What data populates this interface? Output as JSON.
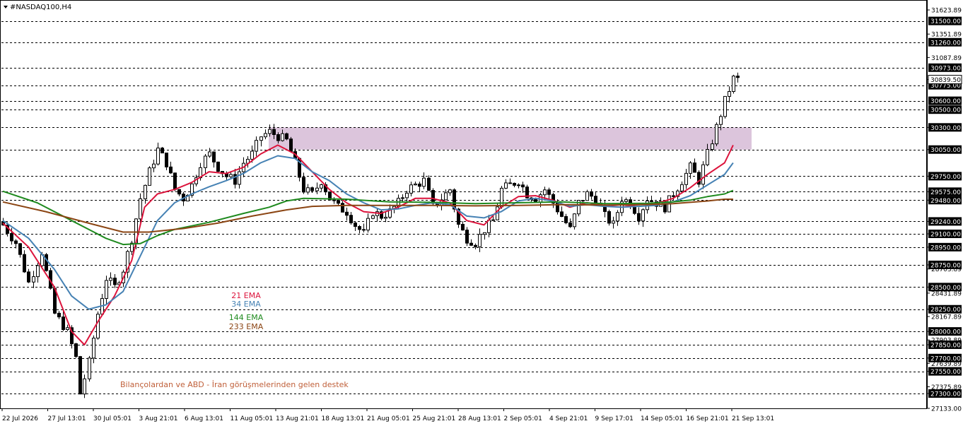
{
  "symbol_label": "#NASDAQ100,H4",
  "colors": {
    "background": "#ffffff",
    "candle": "#000000",
    "grid": "#000000",
    "ema21": "#dc143c",
    "ema34": "#4682b4",
    "ema144": "#1f8a1f",
    "ema233": "#8b4513",
    "zone": "#d8bfd8",
    "tag_bg": "#000000",
    "tag_fg": "#ffffff",
    "note": "#c0603a"
  },
  "legend": [
    {
      "label": "21 EMA",
      "color": "#dc143c"
    },
    {
      "label": "34 EMA",
      "color": "#4682b4"
    },
    {
      "label": "144 EMA",
      "color": "#1f8a1f"
    },
    {
      "label": "233 EMA",
      "color": "#8b4513"
    }
  ],
  "annotation": "Bilançolardan ve ABD - İran görüşmelerinden gelen destek",
  "chart_data": {
    "type": "candlestick",
    "title": "#NASDAQ100,H4",
    "timeframe": "H4",
    "ylim": [
      27133,
      31720
    ],
    "x_ticks": [
      "22 Jul 2026",
      "27 Jul 13:01",
      "30 Jul 05:01",
      "3 Aug 21:01",
      "6 Aug 13:01",
      "11 Aug 05:01",
      "13 Aug 21:01",
      "18 Aug 13:01",
      "21 Aug 05:01",
      "25 Aug 21:01",
      "28 Aug 13:01",
      "2 Sep 05:01",
      "4 Sep 21:01",
      "9 Sep 17:01",
      "14 Sep 05:01",
      "16 Sep 21:01",
      "21 Sep 13:01"
    ],
    "y_scale_labels": [
      "31623.89",
      "31351.89",
      "31087.89",
      "30839.50",
      "30300.00",
      "30050.00",
      "29750.00",
      "29575.00",
      "29480.00",
      "29240.00",
      "29100.00",
      "28950.00",
      "28750.00",
      "28703.89",
      "28500.00",
      "28431.89",
      "28250.00",
      "28167.89",
      "28000.00",
      "27903.89",
      "27850.00",
      "27700.00",
      "27639.89",
      "27550.00",
      "27375.89",
      "27300.00",
      "27133.00"
    ],
    "horizontal_levels": [
      "31500.00",
      "31260.00",
      "30973.00",
      "30775.00",
      "30600.00",
      "30500.00",
      "30300.00",
      "30050.00",
      "29750.00",
      "29575.00",
      "29480.00",
      "29240.00",
      "29100.00",
      "28950.00",
      "28750.00",
      "28500.00",
      "28250.00",
      "28000.00",
      "27850.00",
      "27700.00",
      "27550.00",
      "27300.00"
    ],
    "current_price": "30839.50",
    "zone": {
      "from_date": "13 Aug 05:01",
      "low": 30050,
      "high": 30300
    },
    "close_path": [
      [
        0,
        29200
      ],
      [
        3,
        29000
      ],
      [
        6,
        28550
      ],
      [
        9,
        28900
      ],
      [
        12,
        28200
      ],
      [
        15,
        28000
      ],
      [
        17,
        27700
      ],
      [
        18,
        27300
      ],
      [
        20,
        27650
      ],
      [
        22,
        28200
      ],
      [
        24,
        28600
      ],
      [
        26,
        28500
      ],
      [
        28,
        28700
      ],
      [
        30,
        29050
      ],
      [
        32,
        29500
      ],
      [
        34,
        29800
      ],
      [
        36,
        30050
      ],
      [
        38,
        29900
      ],
      [
        40,
        29600
      ],
      [
        42,
        29500
      ],
      [
        44,
        29650
      ],
      [
        46,
        29900
      ],
      [
        48,
        30000
      ],
      [
        50,
        29850
      ],
      [
        52,
        29750
      ],
      [
        54,
        29700
      ],
      [
        56,
        29900
      ],
      [
        58,
        30000
      ],
      [
        60,
        30200
      ],
      [
        62,
        30250
      ],
      [
        64,
        30200
      ],
      [
        66,
        30150
      ],
      [
        68,
        29900
      ],
      [
        70,
        29600
      ],
      [
        72,
        29550
      ],
      [
        74,
        29700
      ],
      [
        76,
        29500
      ],
      [
        78,
        29400
      ],
      [
        80,
        29350
      ],
      [
        82,
        29200
      ],
      [
        84,
        29100
      ],
      [
        86,
        29350
      ],
      [
        88,
        29300
      ],
      [
        90,
        29350
      ],
      [
        92,
        29450
      ],
      [
        94,
        29600
      ],
      [
        96,
        29650
      ],
      [
        98,
        29700
      ],
      [
        100,
        29400
      ],
      [
        102,
        29500
      ],
      [
        104,
        29600
      ],
      [
        106,
        29200
      ],
      [
        108,
        29050
      ],
      [
        110,
        29000
      ],
      [
        112,
        29150
      ],
      [
        114,
        29250
      ],
      [
        116,
        29600
      ],
      [
        118,
        29650
      ],
      [
        120,
        29700
      ],
      [
        122,
        29550
      ],
      [
        124,
        29500
      ],
      [
        126,
        29600
      ],
      [
        128,
        29450
      ],
      [
        130,
        29300
      ],
      [
        132,
        29150
      ],
      [
        134,
        29450
      ],
      [
        136,
        29550
      ],
      [
        138,
        29500
      ],
      [
        140,
        29300
      ],
      [
        142,
        29200
      ],
      [
        144,
        29500
      ],
      [
        146,
        29450
      ],
      [
        148,
        29300
      ],
      [
        150,
        29500
      ],
      [
        152,
        29450
      ],
      [
        154,
        29400
      ],
      [
        156,
        29550
      ],
      [
        158,
        29700
      ],
      [
        160,
        29850
      ],
      [
        162,
        29700
      ],
      [
        164,
        30000
      ],
      [
        166,
        30300
      ],
      [
        168,
        30600
      ],
      [
        170,
        30850
      ],
      [
        171,
        30839.5
      ]
    ],
    "series": [
      {
        "name": "21 EMA",
        "values": [
          [
            0,
            29220
          ],
          [
            6,
            28950
          ],
          [
            12,
            28500
          ],
          [
            16,
            28000
          ],
          [
            19,
            27850
          ],
          [
            22,
            28100
          ],
          [
            26,
            28400
          ],
          [
            30,
            28800
          ],
          [
            33,
            29400
          ],
          [
            36,
            29550
          ],
          [
            40,
            29600
          ],
          [
            44,
            29680
          ],
          [
            48,
            29800
          ],
          [
            52,
            29780
          ],
          [
            56,
            29850
          ],
          [
            60,
            30000
          ],
          [
            64,
            30100
          ],
          [
            68,
            30000
          ],
          [
            72,
            29800
          ],
          [
            76,
            29600
          ],
          [
            80,
            29450
          ],
          [
            84,
            29350
          ],
          [
            88,
            29330
          ],
          [
            92,
            29400
          ],
          [
            96,
            29500
          ],
          [
            100,
            29500
          ],
          [
            104,
            29450
          ],
          [
            108,
            29250
          ],
          [
            112,
            29200
          ],
          [
            116,
            29400
          ],
          [
            120,
            29520
          ],
          [
            124,
            29530
          ],
          [
            128,
            29480
          ],
          [
            132,
            29400
          ],
          [
            136,
            29450
          ],
          [
            140,
            29420
          ],
          [
            144,
            29400
          ],
          [
            148,
            29430
          ],
          [
            152,
            29440
          ],
          [
            156,
            29500
          ],
          [
            160,
            29620
          ],
          [
            164,
            29770
          ],
          [
            168,
            29900
          ],
          [
            170,
            30100
          ]
        ]
      },
      {
        "name": "34 EMA",
        "values": [
          [
            0,
            29250
          ],
          [
            6,
            29050
          ],
          [
            12,
            28700
          ],
          [
            16,
            28400
          ],
          [
            20,
            28250
          ],
          [
            24,
            28300
          ],
          [
            28,
            28450
          ],
          [
            32,
            28850
          ],
          [
            36,
            29250
          ],
          [
            40,
            29450
          ],
          [
            44,
            29550
          ],
          [
            48,
            29630
          ],
          [
            52,
            29700
          ],
          [
            56,
            29780
          ],
          [
            60,
            29900
          ],
          [
            64,
            29980
          ],
          [
            68,
            29950
          ],
          [
            72,
            29800
          ],
          [
            76,
            29700
          ],
          [
            80,
            29550
          ],
          [
            84,
            29450
          ],
          [
            88,
            29370
          ],
          [
            92,
            29380
          ],
          [
            96,
            29420
          ],
          [
            100,
            29450
          ],
          [
            104,
            29430
          ],
          [
            108,
            29300
          ],
          [
            112,
            29280
          ],
          [
            116,
            29350
          ],
          [
            120,
            29470
          ],
          [
            124,
            29500
          ],
          [
            128,
            29470
          ],
          [
            132,
            29410
          ],
          [
            136,
            29430
          ],
          [
            140,
            29410
          ],
          [
            144,
            29400
          ],
          [
            148,
            29410
          ],
          [
            152,
            29420
          ],
          [
            156,
            29460
          ],
          [
            160,
            29530
          ],
          [
            164,
            29650
          ],
          [
            168,
            29770
          ],
          [
            170,
            29900
          ]
        ]
      },
      {
        "name": "144 EMA",
        "values": [
          [
            0,
            29580
          ],
          [
            8,
            29450
          ],
          [
            16,
            29250
          ],
          [
            24,
            29050
          ],
          [
            28,
            28980
          ],
          [
            32,
            28990
          ],
          [
            36,
            29080
          ],
          [
            40,
            29150
          ],
          [
            48,
            29230
          ],
          [
            56,
            29330
          ],
          [
            62,
            29400
          ],
          [
            66,
            29470
          ],
          [
            70,
            29500
          ],
          [
            80,
            29490
          ],
          [
            90,
            29460
          ],
          [
            100,
            29455
          ],
          [
            110,
            29440
          ],
          [
            120,
            29450
          ],
          [
            130,
            29460
          ],
          [
            140,
            29440
          ],
          [
            150,
            29445
          ],
          [
            156,
            29460
          ],
          [
            160,
            29480
          ],
          [
            164,
            29520
          ],
          [
            168,
            29550
          ],
          [
            170,
            29590
          ]
        ]
      },
      {
        "name": "233 EMA",
        "values": [
          [
            0,
            29460
          ],
          [
            10,
            29350
          ],
          [
            20,
            29220
          ],
          [
            28,
            29120
          ],
          [
            34,
            29120
          ],
          [
            42,
            29160
          ],
          [
            50,
            29220
          ],
          [
            58,
            29300
          ],
          [
            66,
            29370
          ],
          [
            72,
            29410
          ],
          [
            80,
            29420
          ],
          [
            90,
            29420
          ],
          [
            100,
            29420
          ],
          [
            110,
            29415
          ],
          [
            120,
            29420
          ],
          [
            130,
            29430
          ],
          [
            140,
            29425
          ],
          [
            150,
            29430
          ],
          [
            156,
            29440
          ],
          [
            160,
            29455
          ],
          [
            164,
            29470
          ],
          [
            168,
            29490
          ],
          [
            170,
            29490
          ]
        ]
      }
    ]
  }
}
